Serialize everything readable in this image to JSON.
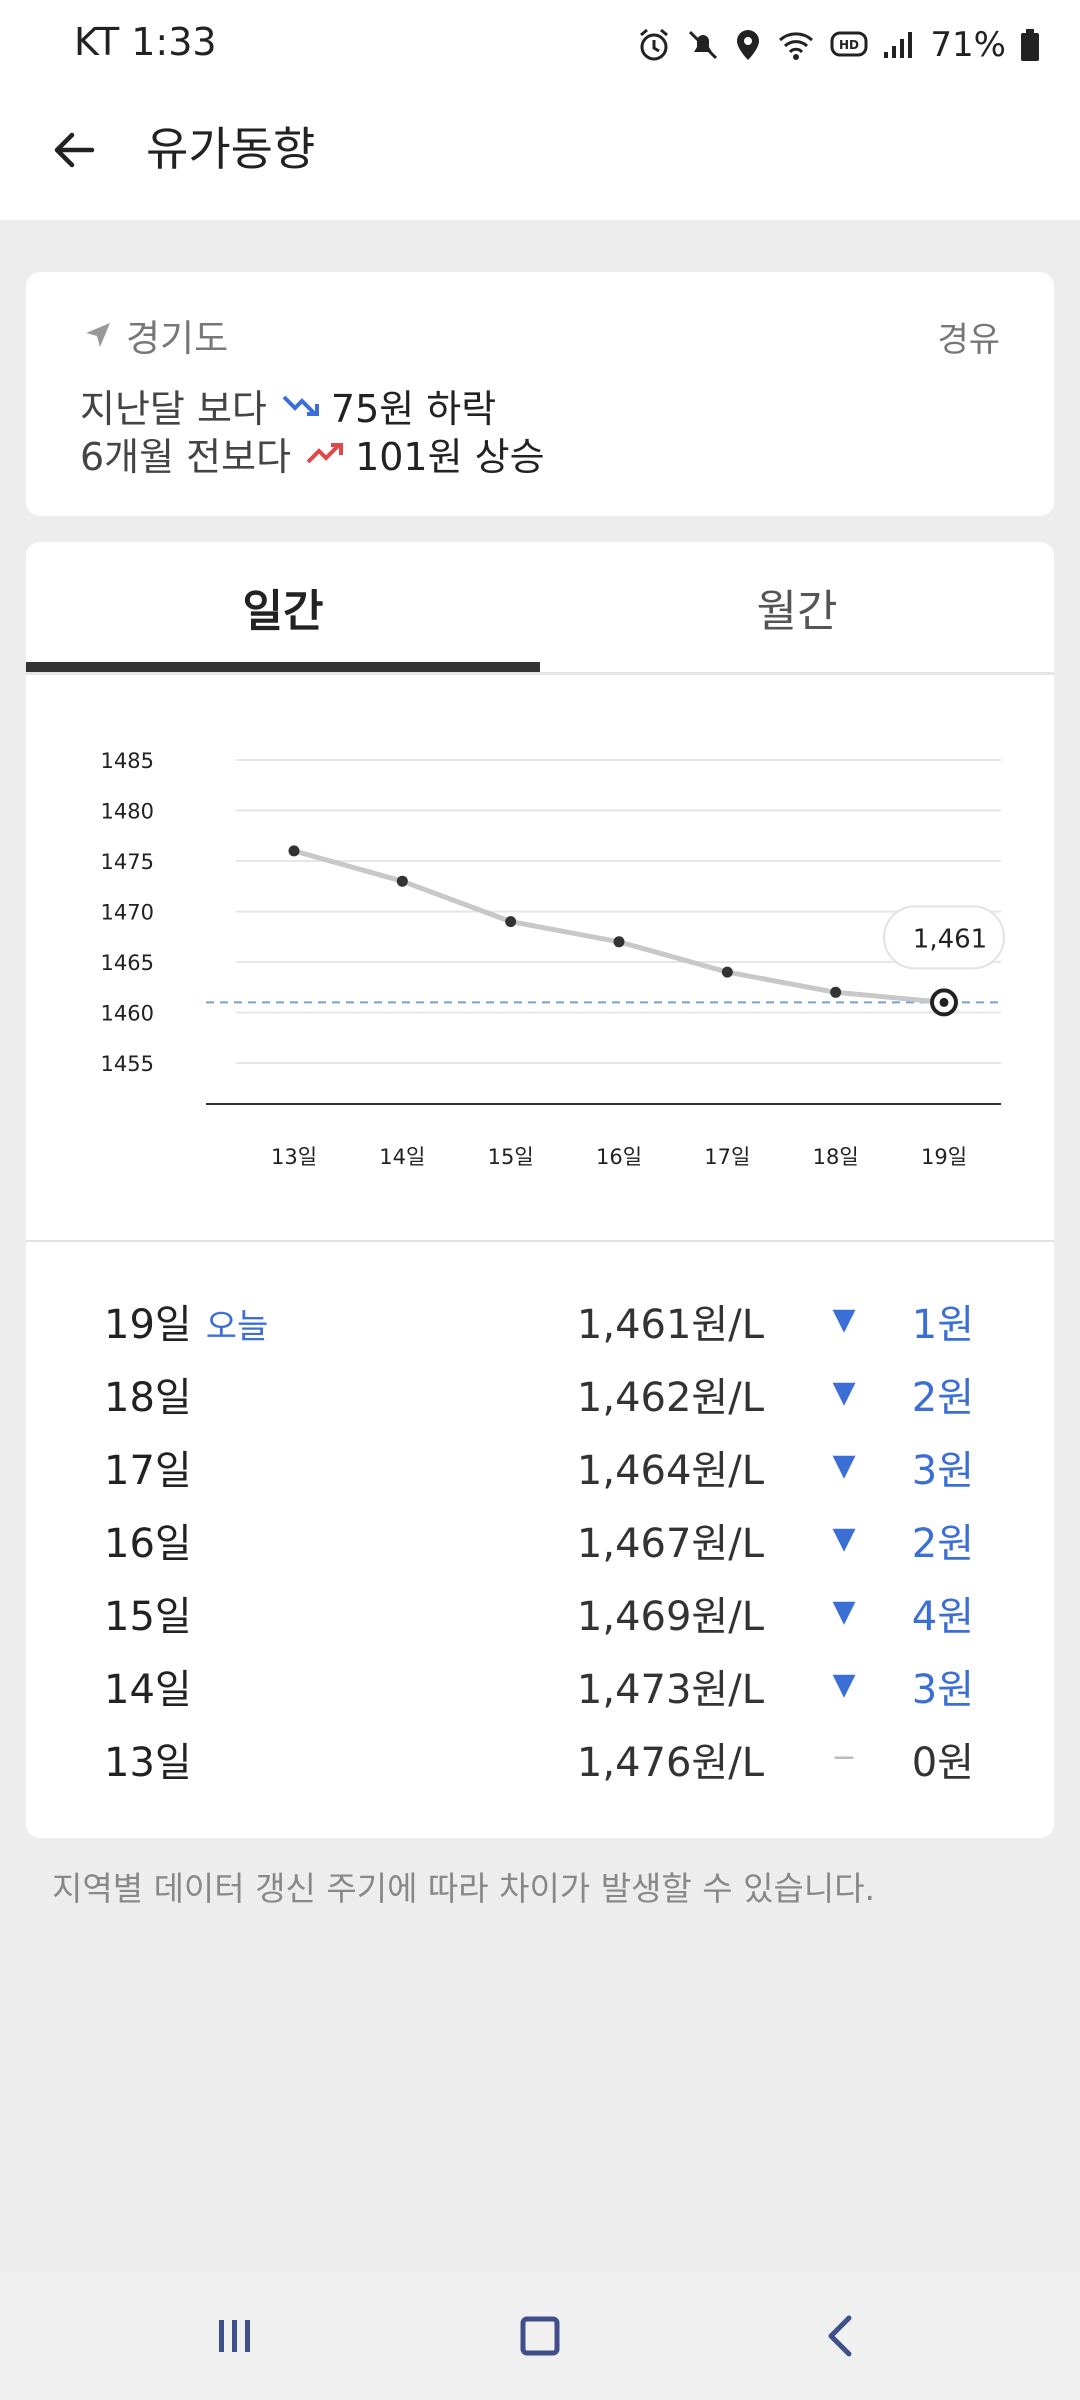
{
  "status": {
    "carrier_time": "KT 1:33",
    "battery": "71%"
  },
  "appbar": {
    "title": "유가동향"
  },
  "summary": {
    "region": "경기도",
    "fuel_type": "경유",
    "line1_prefix": "지난달 보다",
    "line1_value": "75원 하락",
    "line2_prefix": "6개월 전보다",
    "line2_value": "101원 상승",
    "colors": {
      "down": "#3b6fd6",
      "up": "#e0484b"
    }
  },
  "tabs": [
    {
      "label": "일간",
      "active": true
    },
    {
      "label": "월간",
      "active": false
    }
  ],
  "chart_data": {
    "type": "line",
    "categories": [
      "13일",
      "14일",
      "15일",
      "16일",
      "17일",
      "18일",
      "19일"
    ],
    "values": [
      1476,
      1473,
      1469,
      1467,
      1464,
      1462,
      1461
    ],
    "y_ticks": [
      "1485",
      "1480",
      "1475",
      "1470",
      "1465",
      "1460",
      "1455"
    ],
    "ylim": [
      1450,
      1487
    ],
    "reference_value": 1461,
    "callout": "1,461",
    "grid": true,
    "line_color": "#c8c8c8",
    "reference_color": "#7a9fe0"
  },
  "prices": [
    {
      "day": "19일",
      "tag": "오늘",
      "price": "1,461원/L",
      "arrow": "▼",
      "change": "1원",
      "flat": false
    },
    {
      "day": "18일",
      "tag": "",
      "price": "1,462원/L",
      "arrow": "▼",
      "change": "2원",
      "flat": false
    },
    {
      "day": "17일",
      "tag": "",
      "price": "1,464원/L",
      "arrow": "▼",
      "change": "3원",
      "flat": false
    },
    {
      "day": "16일",
      "tag": "",
      "price": "1,467원/L",
      "arrow": "▼",
      "change": "2원",
      "flat": false
    },
    {
      "day": "15일",
      "tag": "",
      "price": "1,469원/L",
      "arrow": "▼",
      "change": "4원",
      "flat": false
    },
    {
      "day": "14일",
      "tag": "",
      "price": "1,473원/L",
      "arrow": "▼",
      "change": "3원",
      "flat": false
    },
    {
      "day": "13일",
      "tag": "",
      "price": "1,476원/L",
      "arrow": "−",
      "change": "0원",
      "flat": true
    }
  ],
  "note": "지역별 데이터 갱신 주기에 따라 차이가 발생할 수 있습니다.",
  "icons": {
    "back": "arrow-left-icon",
    "location": "location-arrow-icon",
    "trend_down": "trend-down-icon",
    "trend_up": "trend-up-icon"
  }
}
